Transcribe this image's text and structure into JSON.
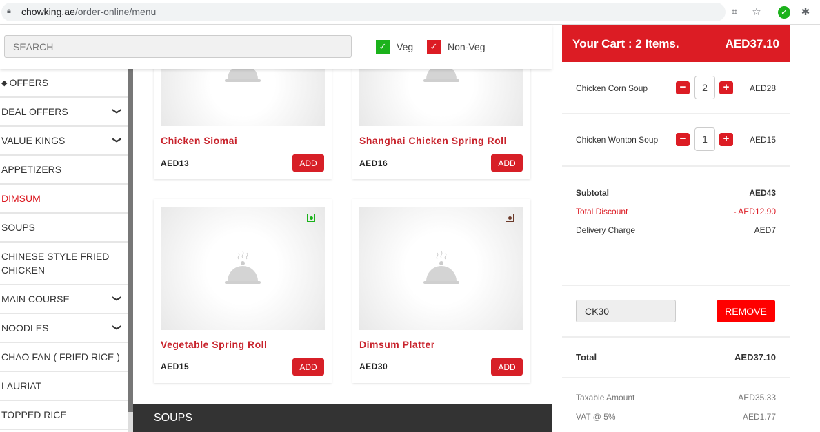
{
  "browser": {
    "url_host": "chowking.ae",
    "url_path": "/order-online/menu"
  },
  "topbar": {
    "search_placeholder": "SEARCH",
    "veg_label": "Veg",
    "nonveg_label": "Non-Veg",
    "veg_color": "#1bb21b",
    "nonveg_color": "#dc1c24"
  },
  "sidebar": {
    "items": [
      {
        "label": "OFFERS",
        "icon": "tag-icon"
      },
      {
        "label": "DEAL OFFERS",
        "expandable": true
      },
      {
        "label": "VALUE KINGS",
        "expandable": true
      },
      {
        "label": "APPETIZERS"
      },
      {
        "label": "DIMSUM",
        "active": true
      },
      {
        "label": "SOUPS"
      },
      {
        "label": "CHINESE STYLE FRIED CHICKEN"
      },
      {
        "label": "MAIN COURSE",
        "expandable": true
      },
      {
        "label": "NOODLES",
        "expandable": true
      },
      {
        "label": "CHAO FAN ( FRIED RICE )"
      },
      {
        "label": "LAURIAT"
      },
      {
        "label": "TOPPED RICE"
      }
    ]
  },
  "products": [
    {
      "name": "Chicken Siomai",
      "price": "AED13",
      "add": "ADD"
    },
    {
      "name": "Shanghai Chicken Spring Roll",
      "price": "AED16",
      "add": "ADD"
    },
    {
      "name": "Vegetable Spring Roll",
      "price": "AED15",
      "add": "ADD",
      "type": "veg"
    },
    {
      "name": "Dimsum Platter",
      "price": "AED30",
      "add": "ADD",
      "type": "non-veg"
    }
  ],
  "section_heading": "SOUPS",
  "cart": {
    "title": "Your Cart : 2 Items.",
    "total_header": "AED37.10",
    "items": [
      {
        "name": "Chicken Corn Soup",
        "qty": "2",
        "amount": "AED28"
      },
      {
        "name": "Chicken Wonton Soup",
        "qty": "1",
        "amount": "AED15"
      }
    ],
    "subtotal_label": "Subtotal",
    "subtotal": "AED43",
    "discount_label": "Total Discount",
    "discount": "- AED12.90",
    "delivery_label": "Delivery Charge",
    "delivery": "AED7",
    "coupon_value": "CK30",
    "remove_label": "REMOVE",
    "total_label": "Total",
    "total": "AED37.10",
    "taxable_label": "Taxable Amount",
    "taxable": "AED35.33",
    "vat_label": "VAT @ 5%",
    "vat": "AED1.77"
  }
}
